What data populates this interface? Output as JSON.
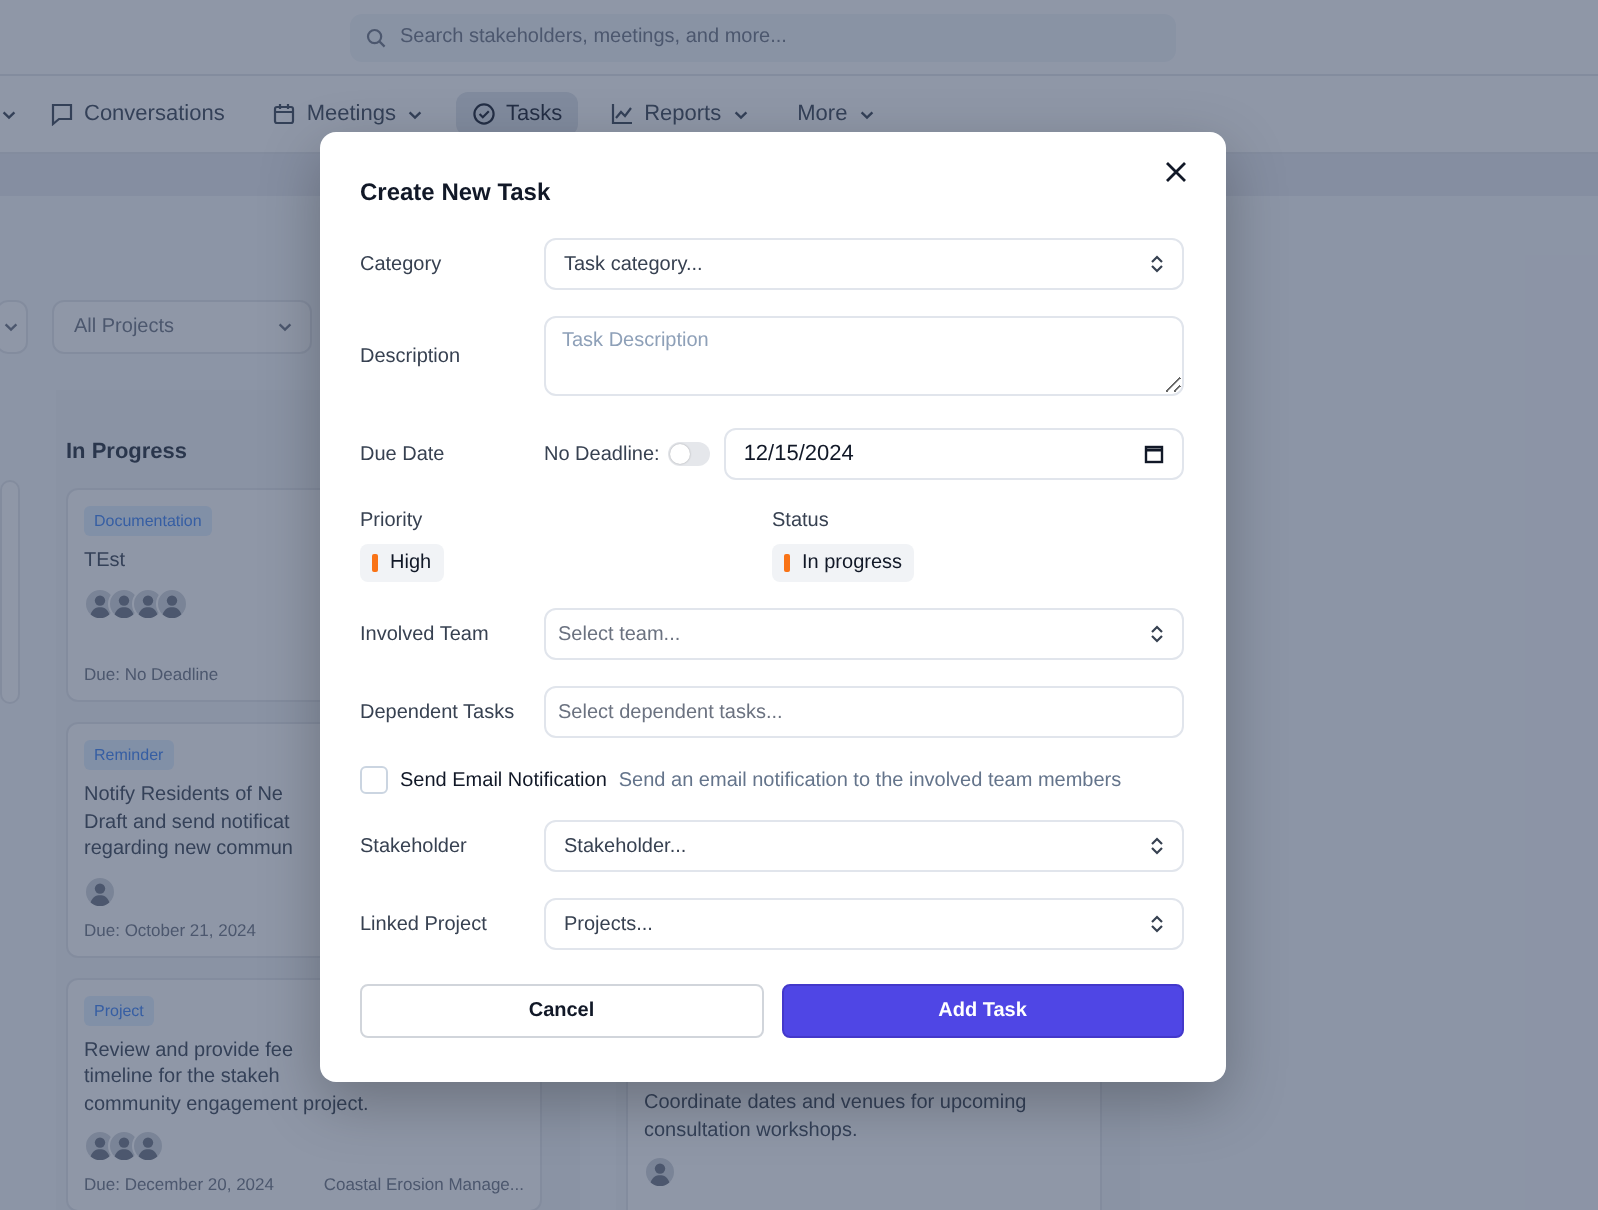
{
  "search": {
    "placeholder": "Search stakeholders, meetings, and more..."
  },
  "nav": [
    {
      "label": "Conversations",
      "dropdown": false,
      "selected": false
    },
    {
      "label": "Meetings",
      "dropdown": true,
      "selected": false
    },
    {
      "label": "Tasks",
      "dropdown": false,
      "selected": true
    },
    {
      "label": "Reports",
      "dropdown": true,
      "selected": false
    },
    {
      "label": "More",
      "dropdown": true,
      "selected": false
    }
  ],
  "filters": [
    {
      "placeholder": "All Projects"
    }
  ],
  "board": {
    "columns": [
      {
        "title": "In Progress",
        "cards": [
          {
            "tag": "Documentation",
            "lines": [
              "TEst"
            ],
            "avatars": [
              {
                "kind": "avatar"
              },
              {
                "kind": "avatar"
              },
              {
                "kind": "avatar"
              },
              {
                "kind": "avatar"
              }
            ],
            "due": "Due: No Deadline"
          },
          {
            "tag": "Reminder",
            "lines": [
              "Notify Residents of Ne",
              "Draft and send notificat",
              "regarding new commun"
            ],
            "avatars": [
              {
                "kind": "avatar"
              }
            ],
            "due": "Due: October 21, 2024"
          },
          {
            "tag": "Project",
            "lines": [
              "Review and provide fee",
              "timeline for the stakeh",
              "community engagement project."
            ],
            "avatars": [
              {
                "kind": "avatar"
              },
              {
                "kind": "avatar"
              },
              {
                "kind": "avatar"
              }
            ],
            "due": "Due: December 20, 2024",
            "project": "Coastal Erosion Manage..."
          }
        ]
      },
      {
        "cards": [
          {
            "lines": [
              "Coordinate dates and venues for upcoming",
              "consultation workshops."
            ],
            "avatars": [
              {
                "kind": "avatar"
              }
            ]
          }
        ]
      }
    ]
  },
  "modal": {
    "title": "Create New Task",
    "fields": [
      {
        "kind": "select",
        "label": "Category",
        "value": "Task category..."
      },
      {
        "kind": "textarea",
        "label": "Description",
        "placeholder": "Task Description"
      },
      {
        "kind": "date",
        "label": "Due Date",
        "toggle_label": "No Deadline:",
        "toggle_on": false,
        "value": "12/15/2024"
      },
      {
        "kind": "badges",
        "items": [
          {
            "label": "Priority",
            "value": "High",
            "color": "#f97316"
          },
          {
            "label": "Status",
            "value": "In progress",
            "color": "#f97316"
          }
        ]
      },
      {
        "kind": "select",
        "label": "Involved Team",
        "placeholder": "Select team..."
      },
      {
        "kind": "multi",
        "label": "Dependent Tasks",
        "placeholder": "Select dependent tasks..."
      },
      {
        "kind": "checkbox",
        "label": "Send Email Notification",
        "hint": "Send an email notification to the involved team members",
        "checked": false
      },
      {
        "kind": "select",
        "label": "Stakeholder",
        "value": "Stakeholder..."
      },
      {
        "kind": "select",
        "label": "Linked Project",
        "value": "Projects..."
      }
    ],
    "buttons": [
      {
        "label": "Cancel",
        "kind": "secondary"
      },
      {
        "label": "Add Task",
        "kind": "primary"
      }
    ]
  }
}
